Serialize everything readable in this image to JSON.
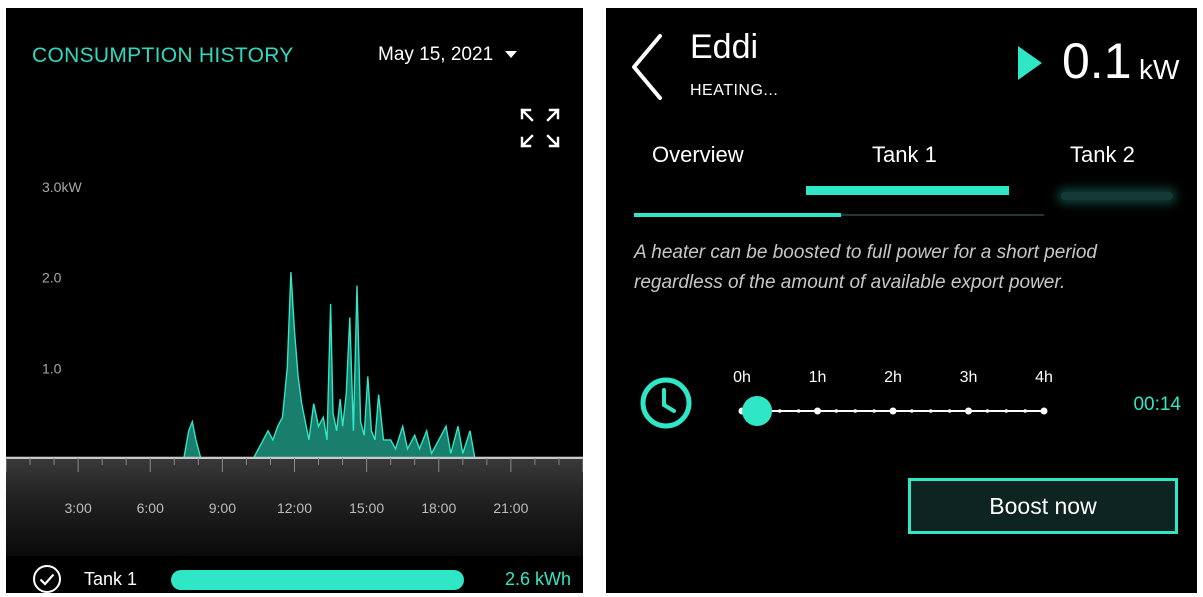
{
  "consumption": {
    "title": "CONSUMPTION HISTORY",
    "date": "May 15, 2021",
    "colors": {
      "accent": "#2fe6c6",
      "title": "#2fd9bf"
    },
    "legend": {
      "label": "Tank 1",
      "value": "2.6 kWh"
    }
  },
  "chart_data": {
    "type": "area",
    "title": "",
    "xlabel": "",
    "ylabel": "",
    "y_tick_labels": [
      "3.0kW",
      "2.0",
      "1.0"
    ],
    "y_ticks": [
      3.0,
      2.0,
      1.0
    ],
    "x_tick_labels": [
      "3:00",
      "6:00",
      "9:00",
      "12:00",
      "15:00",
      "18:00",
      "21:00"
    ],
    "x_ticks": [
      3,
      6,
      9,
      12,
      15,
      18,
      21
    ],
    "xlim": [
      0,
      24
    ],
    "ylim": [
      0,
      3.6
    ],
    "grid": false,
    "series": [
      {
        "color": "#2fe6c6",
        "points": [
          [
            0,
            0
          ],
          [
            7.4,
            0
          ],
          [
            7.6,
            0.3
          ],
          [
            7.75,
            0.4
          ],
          [
            7.9,
            0.2
          ],
          [
            8.1,
            0
          ],
          [
            10.3,
            0
          ],
          [
            10.6,
            0.15
          ],
          [
            10.9,
            0.3
          ],
          [
            11.1,
            0.2
          ],
          [
            11.3,
            0.35
          ],
          [
            11.5,
            0.45
          ],
          [
            11.7,
            1.0
          ],
          [
            11.85,
            2.05
          ],
          [
            12.0,
            1.4
          ],
          [
            12.15,
            0.9
          ],
          [
            12.3,
            0.6
          ],
          [
            12.45,
            0.4
          ],
          [
            12.6,
            0.2
          ],
          [
            12.8,
            0.6
          ],
          [
            13.0,
            0.35
          ],
          [
            13.2,
            0.45
          ],
          [
            13.35,
            0.2
          ],
          [
            13.5,
            1.7
          ],
          [
            13.6,
            0.5
          ],
          [
            13.75,
            0.3
          ],
          [
            13.9,
            0.65
          ],
          [
            14.0,
            0.35
          ],
          [
            14.15,
            0.7
          ],
          [
            14.3,
            1.55
          ],
          [
            14.45,
            0.3
          ],
          [
            14.6,
            1.9
          ],
          [
            14.75,
            0.4
          ],
          [
            14.9,
            0.25
          ],
          [
            15.05,
            0.9
          ],
          [
            15.2,
            0.3
          ],
          [
            15.35,
            0.2
          ],
          [
            15.5,
            0.7
          ],
          [
            15.7,
            0.2
          ],
          [
            16.0,
            0.2
          ],
          [
            16.2,
            0.1
          ],
          [
            16.5,
            0.35
          ],
          [
            16.7,
            0.1
          ],
          [
            17.0,
            0.25
          ],
          [
            17.2,
            0.1
          ],
          [
            17.5,
            0.3
          ],
          [
            17.7,
            0.05
          ],
          [
            18.0,
            0.2
          ],
          [
            18.3,
            0.35
          ],
          [
            18.5,
            0.05
          ],
          [
            18.8,
            0.35
          ],
          [
            19.0,
            0.05
          ],
          [
            19.3,
            0.3
          ],
          [
            19.5,
            0.0
          ],
          [
            24,
            0
          ]
        ]
      }
    ]
  },
  "device": {
    "name": "Eddi",
    "status": "HEATING...",
    "power_value": "0.1",
    "power_unit": "kW"
  },
  "tabs": [
    {
      "label": "Overview"
    },
    {
      "label": "Tank 1",
      "active": true
    },
    {
      "label": "Tank 2"
    }
  ],
  "boost": {
    "description": "A heater can be boosted to full power for a short period regardless of the amount of available export power.",
    "slider_labels": [
      "0h",
      "1h",
      "2h",
      "3h",
      "4h"
    ],
    "slider_value_hours": 0.2,
    "time": "00:14",
    "button_label": "Boost now"
  }
}
